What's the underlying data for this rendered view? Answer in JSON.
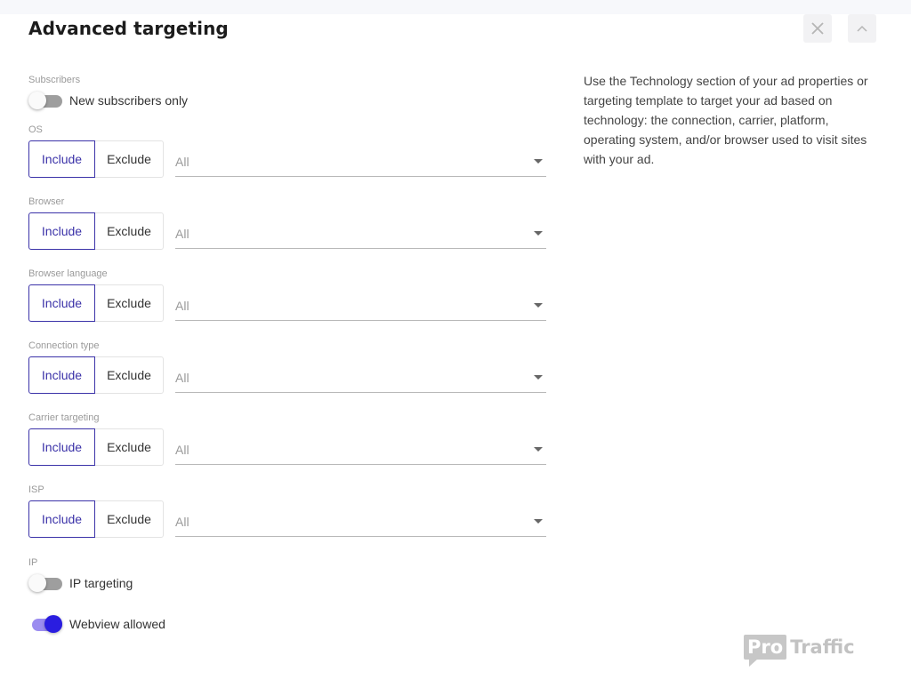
{
  "header": {
    "title": "Advanced targeting",
    "close_icon": "close-icon",
    "collapse_icon": "chevron-up-icon"
  },
  "info_text": "Use the Technology section of your ad properties or targeting template to target your ad based on technology: the connection, carrier, platform, operating system, and/or browser used to visit sites with your ad.",
  "subscribers": {
    "label": "Subscribers",
    "toggle_label": "New subscribers only",
    "enabled": false
  },
  "filters": [
    {
      "label": "OS",
      "include": "Include",
      "exclude": "Exclude",
      "value": "All"
    },
    {
      "label": "Browser",
      "include": "Include",
      "exclude": "Exclude",
      "value": "All"
    },
    {
      "label": "Browser language",
      "include": "Include",
      "exclude": "Exclude",
      "value": "All"
    },
    {
      "label": "Connection type",
      "include": "Include",
      "exclude": "Exclude",
      "value": "All"
    },
    {
      "label": "Carrier targeting",
      "include": "Include",
      "exclude": "Exclude",
      "value": "All"
    },
    {
      "label": "ISP",
      "include": "Include",
      "exclude": "Exclude",
      "value": "All"
    }
  ],
  "ip": {
    "label": "IP",
    "toggle_label": "IP targeting",
    "enabled": false
  },
  "webview": {
    "toggle_label": "Webview allowed",
    "enabled": true
  },
  "logo": {
    "badge": "Pro",
    "word": "Traffic"
  },
  "colors": {
    "accent": "#3b32a8",
    "toggle_on_knob": "#2a1de0",
    "toggle_on_track": "#9b8cf0",
    "toggle_off_track": "#9e9e9e"
  }
}
